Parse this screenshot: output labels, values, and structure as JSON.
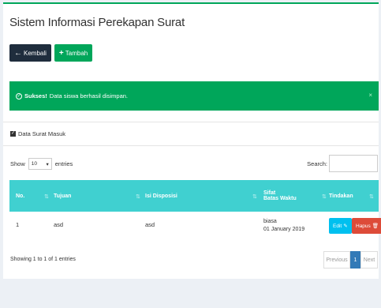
{
  "header": {
    "title": "Sistem Informasi Perekapan Surat"
  },
  "toolbar": {
    "back_label": "Kembali",
    "back_glyph": "←",
    "add_label": "Tambah",
    "add_glyph": "+"
  },
  "alert": {
    "strong": "Sukses!",
    "message": "Data siswa berhasil disimpan.",
    "close": "×",
    "check": "✓"
  },
  "box": {
    "title": "Data Surat Masuk",
    "icon": "✓"
  },
  "length": {
    "show_label": "Show",
    "value": "10",
    "arrow": "▾",
    "entries_label": "entries"
  },
  "search": {
    "label": "Search:"
  },
  "table": {
    "columns": [
      {
        "label": "No."
      },
      {
        "label": "Tujuan"
      },
      {
        "label": "Isi Disposisi"
      },
      {
        "label": "Sifat",
        "label2": "Batas Waktu"
      },
      {
        "label": "Tindakan"
      }
    ],
    "sort_glyph": "⇅",
    "rows": [
      {
        "no": "1",
        "tujuan": "asd",
        "isi": "asd",
        "sifat": "biasa",
        "batas": "01 January 2019",
        "edit_label": "Edit",
        "edit_glyph": "✎",
        "delete_label": "Hapus",
        "delete_glyph": "🗑"
      }
    ]
  },
  "footer": {
    "info": "Showing 1 to 1 of 1 entries",
    "pager": {
      "previous": "Previous",
      "current": "1",
      "next": "Next"
    }
  },
  "colors": {
    "success": "#00a65a",
    "header": "#40d0d0",
    "info": "#00c0ef",
    "danger": "#dd4b39",
    "primary": "#337ab7",
    "dark": "#1f2d3d"
  }
}
